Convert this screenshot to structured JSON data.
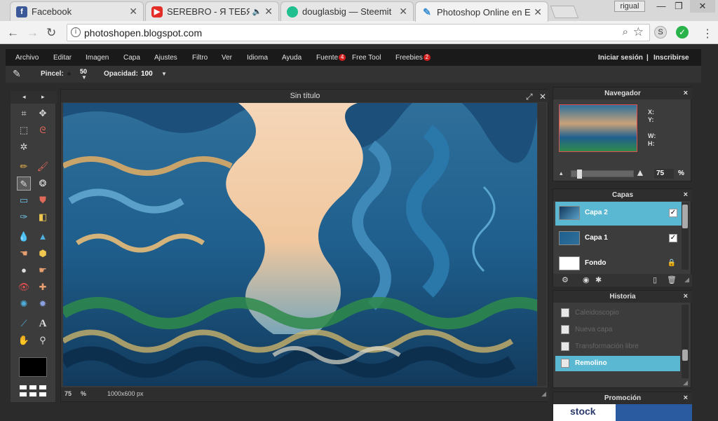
{
  "browser": {
    "tabs": [
      {
        "title": "Facebook",
        "favicon": "facebook-icon",
        "color": "#3b5998"
      },
      {
        "title": "SEREBRO - Я ТЕБЯ НЕ",
        "favicon": "youtube-icon",
        "color": "#e52d27"
      },
      {
        "title": "douglasbig — Steemit",
        "favicon": "steemit-icon",
        "color": "#1fbf8f"
      },
      {
        "title": "Photoshop Online en Esp",
        "favicon": "photoshop-online-icon",
        "color": "#3a8fd1"
      }
    ],
    "profile_name": "rigual",
    "url": "photoshopen.blogspot.com",
    "ext_s": "S"
  },
  "menu": {
    "items": [
      "Archivo",
      "Editar",
      "Imagen",
      "Capa",
      "Ajustes",
      "Filtro",
      "Ver",
      "Idioma",
      "Ayuda",
      "Fuente",
      "Free Tool",
      "Freebies"
    ],
    "fuente_badge": "4",
    "freebies_badge": "2",
    "login": "Iniciar sesión",
    "separator": "|",
    "signup": "Inscribirse"
  },
  "tool_options": {
    "brush_label": "Pincel:",
    "brush_size": "50",
    "opacity_label": "Opacidad:",
    "opacity_value": "100"
  },
  "document": {
    "title": "Sin título",
    "zoom": "75",
    "zoom_unit": "%",
    "dimensions": "1000x600 px"
  },
  "navigator": {
    "title": "Navegador",
    "x_label": "X:",
    "y_label": "Y:",
    "w_label": "W:",
    "h_label": "H:",
    "zoom": "75",
    "zoom_unit": "%",
    "zoom_level": 0.1
  },
  "layers": {
    "title": "Capas",
    "items": [
      {
        "name": "Capa 2",
        "selected": true,
        "visible_check": "✓"
      },
      {
        "name": "Capa 1",
        "selected": false,
        "visible_check": "✓"
      },
      {
        "name": "Fondo",
        "selected": false,
        "locked": true
      }
    ]
  },
  "history": {
    "title": "Historia",
    "items": [
      {
        "label": "Caleidoscopio",
        "selected": false
      },
      {
        "label": "Nueva capa",
        "selected": false
      },
      {
        "label": "Transformación libre",
        "selected": false
      },
      {
        "label": "Remolino",
        "selected": true
      }
    ]
  },
  "promo": {
    "title": "Promoción",
    "brand": "stock"
  },
  "colors": {
    "accent": "#5bb8d2",
    "menu_bg": "#1a1a1a",
    "panel_bg": "#3c3c3c"
  }
}
